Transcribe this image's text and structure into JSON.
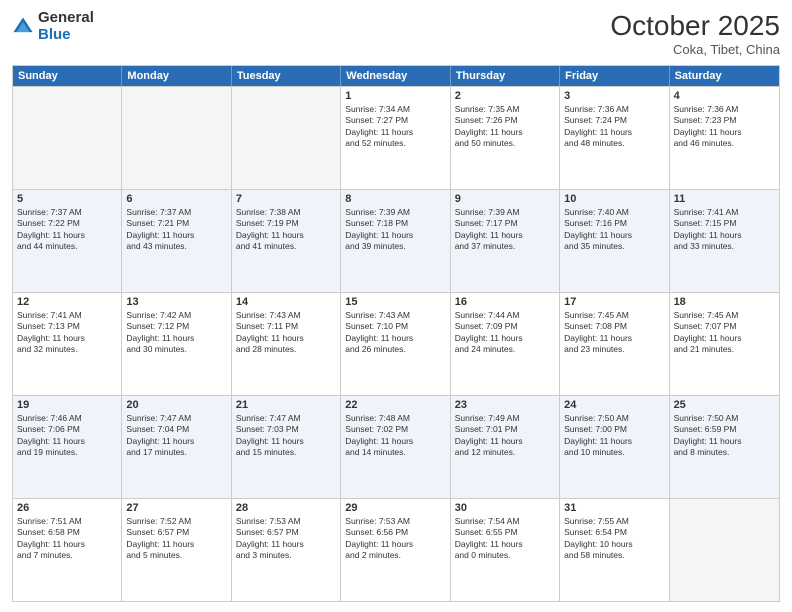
{
  "header": {
    "logo_general": "General",
    "logo_blue": "Blue",
    "month_title": "October 2025",
    "subtitle": "Coka, Tibet, China"
  },
  "weekdays": [
    "Sunday",
    "Monday",
    "Tuesday",
    "Wednesday",
    "Thursday",
    "Friday",
    "Saturday"
  ],
  "rows": [
    [
      {
        "date": "",
        "info": "",
        "empty": true
      },
      {
        "date": "",
        "info": "",
        "empty": true
      },
      {
        "date": "",
        "info": "",
        "empty": true
      },
      {
        "date": "1",
        "info": "Sunrise: 7:34 AM\nSunset: 7:27 PM\nDaylight: 11 hours\nand 52 minutes."
      },
      {
        "date": "2",
        "info": "Sunrise: 7:35 AM\nSunset: 7:26 PM\nDaylight: 11 hours\nand 50 minutes."
      },
      {
        "date": "3",
        "info": "Sunrise: 7:36 AM\nSunset: 7:24 PM\nDaylight: 11 hours\nand 48 minutes."
      },
      {
        "date": "4",
        "info": "Sunrise: 7:36 AM\nSunset: 7:23 PM\nDaylight: 11 hours\nand 46 minutes."
      }
    ],
    [
      {
        "date": "5",
        "info": "Sunrise: 7:37 AM\nSunset: 7:22 PM\nDaylight: 11 hours\nand 44 minutes."
      },
      {
        "date": "6",
        "info": "Sunrise: 7:37 AM\nSunset: 7:21 PM\nDaylight: 11 hours\nand 43 minutes."
      },
      {
        "date": "7",
        "info": "Sunrise: 7:38 AM\nSunset: 7:19 PM\nDaylight: 11 hours\nand 41 minutes."
      },
      {
        "date": "8",
        "info": "Sunrise: 7:39 AM\nSunset: 7:18 PM\nDaylight: 11 hours\nand 39 minutes."
      },
      {
        "date": "9",
        "info": "Sunrise: 7:39 AM\nSunset: 7:17 PM\nDaylight: 11 hours\nand 37 minutes."
      },
      {
        "date": "10",
        "info": "Sunrise: 7:40 AM\nSunset: 7:16 PM\nDaylight: 11 hours\nand 35 minutes."
      },
      {
        "date": "11",
        "info": "Sunrise: 7:41 AM\nSunset: 7:15 PM\nDaylight: 11 hours\nand 33 minutes."
      }
    ],
    [
      {
        "date": "12",
        "info": "Sunrise: 7:41 AM\nSunset: 7:13 PM\nDaylight: 11 hours\nand 32 minutes."
      },
      {
        "date": "13",
        "info": "Sunrise: 7:42 AM\nSunset: 7:12 PM\nDaylight: 11 hours\nand 30 minutes."
      },
      {
        "date": "14",
        "info": "Sunrise: 7:43 AM\nSunset: 7:11 PM\nDaylight: 11 hours\nand 28 minutes."
      },
      {
        "date": "15",
        "info": "Sunrise: 7:43 AM\nSunset: 7:10 PM\nDaylight: 11 hours\nand 26 minutes."
      },
      {
        "date": "16",
        "info": "Sunrise: 7:44 AM\nSunset: 7:09 PM\nDaylight: 11 hours\nand 24 minutes."
      },
      {
        "date": "17",
        "info": "Sunrise: 7:45 AM\nSunset: 7:08 PM\nDaylight: 11 hours\nand 23 minutes."
      },
      {
        "date": "18",
        "info": "Sunrise: 7:45 AM\nSunset: 7:07 PM\nDaylight: 11 hours\nand 21 minutes."
      }
    ],
    [
      {
        "date": "19",
        "info": "Sunrise: 7:46 AM\nSunset: 7:06 PM\nDaylight: 11 hours\nand 19 minutes."
      },
      {
        "date": "20",
        "info": "Sunrise: 7:47 AM\nSunset: 7:04 PM\nDaylight: 11 hours\nand 17 minutes."
      },
      {
        "date": "21",
        "info": "Sunrise: 7:47 AM\nSunset: 7:03 PM\nDaylight: 11 hours\nand 15 minutes."
      },
      {
        "date": "22",
        "info": "Sunrise: 7:48 AM\nSunset: 7:02 PM\nDaylight: 11 hours\nand 14 minutes."
      },
      {
        "date": "23",
        "info": "Sunrise: 7:49 AM\nSunset: 7:01 PM\nDaylight: 11 hours\nand 12 minutes."
      },
      {
        "date": "24",
        "info": "Sunrise: 7:50 AM\nSunset: 7:00 PM\nDaylight: 11 hours\nand 10 minutes."
      },
      {
        "date": "25",
        "info": "Sunrise: 7:50 AM\nSunset: 6:59 PM\nDaylight: 11 hours\nand 8 minutes."
      }
    ],
    [
      {
        "date": "26",
        "info": "Sunrise: 7:51 AM\nSunset: 6:58 PM\nDaylight: 11 hours\nand 7 minutes."
      },
      {
        "date": "27",
        "info": "Sunrise: 7:52 AM\nSunset: 6:57 PM\nDaylight: 11 hours\nand 5 minutes."
      },
      {
        "date": "28",
        "info": "Sunrise: 7:53 AM\nSunset: 6:57 PM\nDaylight: 11 hours\nand 3 minutes."
      },
      {
        "date": "29",
        "info": "Sunrise: 7:53 AM\nSunset: 6:56 PM\nDaylight: 11 hours\nand 2 minutes."
      },
      {
        "date": "30",
        "info": "Sunrise: 7:54 AM\nSunset: 6:55 PM\nDaylight: 11 hours\nand 0 minutes."
      },
      {
        "date": "31",
        "info": "Sunrise: 7:55 AM\nSunset: 6:54 PM\nDaylight: 10 hours\nand 58 minutes."
      },
      {
        "date": "",
        "info": "",
        "empty": true
      }
    ]
  ]
}
